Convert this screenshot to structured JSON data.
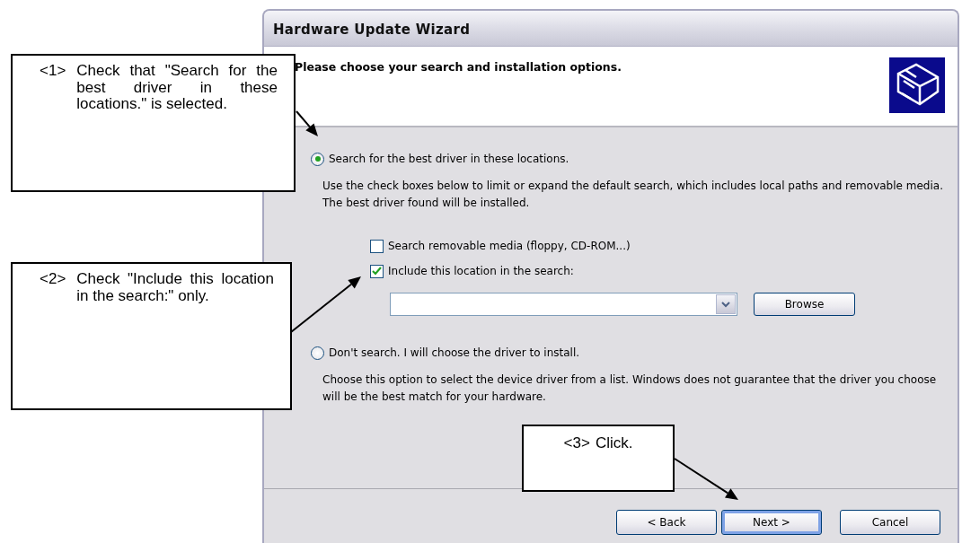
{
  "window": {
    "title": "Hardware Update Wizard"
  },
  "header": {
    "heading": "Please choose your search and installation options."
  },
  "options": [
    {
      "kind": "search",
      "label": "Search for the best driver in these locations.",
      "selected": true,
      "description": "Use the check boxes below to limit or expand the default search, which includes local paths and removable media. The best driver found will be installed.",
      "checkboxes": [
        {
          "label": "Search removable media (floppy, CD-ROM...)",
          "checked": false
        },
        {
          "label": "Include this location in the search:",
          "checked": true
        }
      ],
      "browse_button": "Browse"
    },
    {
      "kind": "manual",
      "label": "Don't search. I will choose the driver to install.",
      "selected": false,
      "description": "Choose this option to select the device driver from a list.  Windows does not guarantee that the driver you choose will be the best match for your hardware."
    }
  ],
  "buttons": [
    {
      "label": "< Back",
      "default": false
    },
    {
      "label": "Next >",
      "default": true
    },
    {
      "label": "Cancel",
      "default": false
    }
  ],
  "callouts": [
    {
      "number": "<1>",
      "text": "Check that \"Search for the best driver in these locations.\" is selected."
    },
    {
      "number": "<2>",
      "text": "Check \"Include this location in the search:\" only."
    },
    {
      "number": "<3>",
      "text": "Click."
    }
  ]
}
